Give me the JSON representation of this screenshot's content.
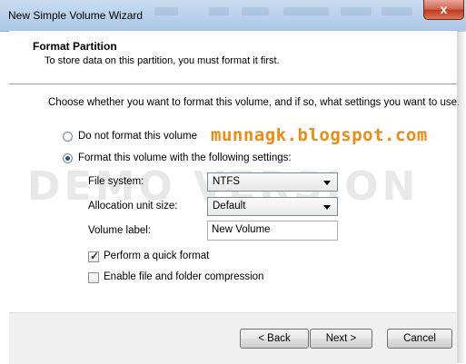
{
  "window": {
    "title": "New Simple Volume Wizard",
    "close_label": "x"
  },
  "header": {
    "title": "Format Partition",
    "subtitle": "To store data on this partition, you must format it first."
  },
  "content": {
    "prompt": "Choose whether you want to format this volume, and if so, what settings you want to use.",
    "option_no_format": "Do not format this volume",
    "option_format": "Format this volume with the following settings:",
    "selected_option": "format",
    "overlay_text": "munnagk.blogspot.com",
    "watermark": "DEMO VERSION",
    "file_system": {
      "label": "File system:",
      "value": "NTFS"
    },
    "allocation": {
      "label": "Allocation unit size:",
      "value": "Default"
    },
    "volume_label": {
      "label": "Volume label:",
      "value": "New Volume"
    },
    "quick_format": {
      "label": "Perform a quick format",
      "checked": true
    },
    "compression": {
      "label": "Enable file and folder compression",
      "checked": false
    }
  },
  "footer": {
    "back": "< Back",
    "next": "Next >",
    "cancel": "Cancel"
  },
  "colors": {
    "overlay": "#f08a10",
    "titlebar": "#b7d0ea",
    "close": "#c13a1f"
  }
}
